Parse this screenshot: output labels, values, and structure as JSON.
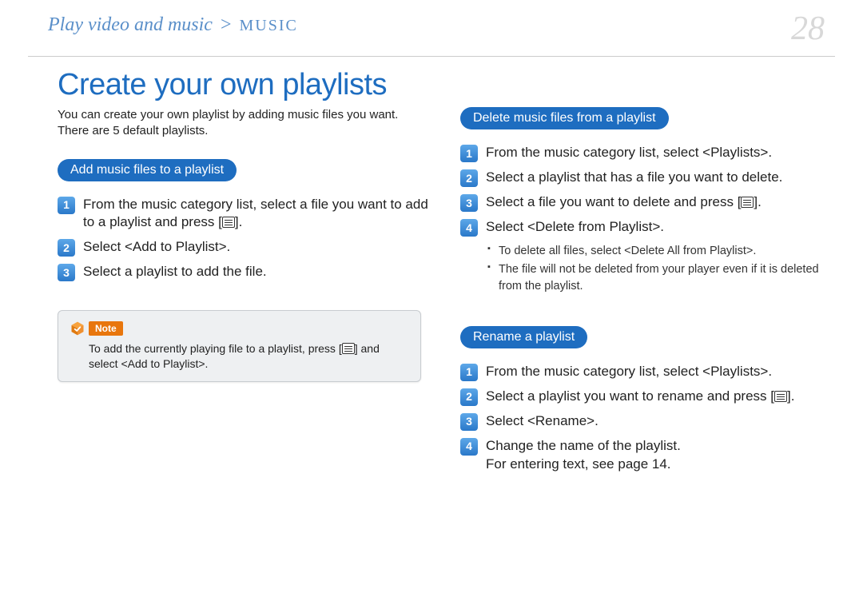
{
  "header": {
    "breadcrumb_parent": "Play video and music",
    "breadcrumb_section": "MUSIC",
    "page_number": "28"
  },
  "title": "Create your own playlists",
  "intro": "You can create your own playlist by adding music files you want. There are 5 default playlists.",
  "section_add": {
    "heading": "Add music files to a playlist",
    "steps": [
      "From the music category list, select a file you want to add to a playlist and press [≡].",
      "Select <Add to Playlist>.",
      "Select a playlist to add the file."
    ]
  },
  "note": {
    "label": "Note",
    "text": "To add the currently playing file to a playlist, press [≡] and select <Add to Playlist>."
  },
  "section_delete": {
    "heading": "Delete music files from a playlist",
    "steps": [
      "From the music category list, select <Playlists>.",
      "Select a playlist that has a file you want to delete.",
      "Select a file you want to delete and press [≡].",
      "Select <Delete from Playlist>."
    ],
    "bullets": [
      "To delete all files, select <Delete All from Playlist>.",
      "The file will not be deleted from your player even if it is deleted from the playlist."
    ]
  },
  "section_rename": {
    "heading": "Rename a playlist",
    "steps": [
      "From the music category list, select <Playlists>.",
      "Select a playlist you want to rename and press [≡].",
      "Select <Rename>.",
      "Change the name of the playlist.\nFor entering text, see page 14."
    ]
  }
}
